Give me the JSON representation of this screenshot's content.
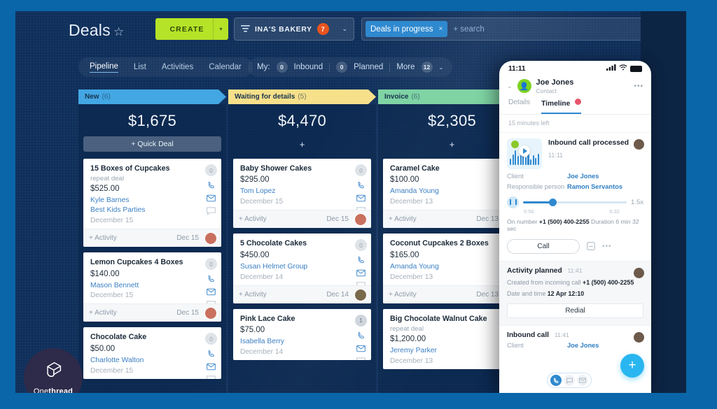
{
  "header": {
    "title": "Deals",
    "star_icon": "star-outline-icon",
    "create_label": "CREATE",
    "create_caret": "▾",
    "filter_icon": "filter-icon",
    "business": "INA'S BAKERY",
    "business_badge": "7",
    "business_caret": "⌄"
  },
  "search": {
    "chip": "Deals in progress",
    "chip_close": "×",
    "placeholder": "+ search"
  },
  "nav": {
    "tabs": [
      {
        "label": "Pipeline",
        "active": true
      },
      {
        "label": "List",
        "active": false
      },
      {
        "label": "Activities",
        "active": false
      },
      {
        "label": "Calendar",
        "active": false
      }
    ],
    "my_label": "My:",
    "inbound_count": "0",
    "inbound_label": "Inbound",
    "planned_count": "0",
    "planned_label": "Planned",
    "more_label": "More",
    "more_count": "12",
    "more_caret": "⌄"
  },
  "columns": [
    {
      "name": "New",
      "count": "(6)",
      "color": "#43a7e4",
      "sum": "$1,675",
      "action_label": "+ Quick Deal",
      "action_type": "quick",
      "cards": [
        {
          "title": "15 Boxes of Cupcakes",
          "sub": "repeat deal",
          "amount": "$525.00",
          "person": "Kyle Barnes",
          "org": "Best Kids Parties",
          "date": "December 15",
          "badge": "0",
          "foot_action": "+ Activity",
          "foot_date": "Dec 15"
        },
        {
          "title": "Lemon Cupcakes 4 Boxes",
          "sub": "",
          "amount": "$140.00",
          "person": "Mason Bennett",
          "org": "",
          "date": "December 15",
          "badge": "0",
          "foot_action": "+ Activity",
          "foot_date": "Dec 15"
        },
        {
          "title": "Chocolate Cake",
          "sub": "",
          "amount": "$50.00",
          "person": "Charlotte Walton",
          "org": "",
          "date": "December 15",
          "badge": "0",
          "foot_action": "",
          "foot_date": ""
        }
      ]
    },
    {
      "name": "Waiting for details",
      "count": "(5)",
      "color": "#f7e08a",
      "sum": "$4,470",
      "action_label": "+",
      "action_type": "plus",
      "cards": [
        {
          "title": "Baby Shower Cakes",
          "sub": "",
          "amount": "$295.00",
          "person": "Tom Lopez",
          "org": "",
          "date": "December 15",
          "badge": "0",
          "foot_action": "+ Activity",
          "foot_date": "Dec 15"
        },
        {
          "title": "5 Chocolate Cakes",
          "sub": "",
          "amount": "$450.00",
          "person": "Susan Helmet Group",
          "org": "",
          "date": "December 14",
          "badge": "0",
          "foot_action": "+ Activity",
          "foot_date": "Dec 14"
        },
        {
          "title": "Pink Lace Cake",
          "sub": "",
          "amount": "$75.00",
          "person": "Isabella Berry",
          "org": "",
          "date": "December 14",
          "badge": "1",
          "foot_action": "",
          "foot_date": ""
        }
      ]
    },
    {
      "name": "Invoice",
      "count": "(6)",
      "color": "#7fd3a4",
      "sum": "$2,305",
      "action_label": "+",
      "action_type": "plus",
      "cards": [
        {
          "title": "Caramel Cake",
          "sub": "",
          "amount": "$100.00",
          "person": "Amanda Young",
          "org": "",
          "date": "December 13",
          "badge": "0",
          "foot_action": "+ Activity",
          "foot_date": "Dec 13"
        },
        {
          "title": "Coconut Cupcakes 2 Boxes",
          "sub": "",
          "amount": "$165.00",
          "person": "Amanda Young",
          "org": "",
          "date": "December 13",
          "badge": "0",
          "foot_action": "+ Activity",
          "foot_date": "Dec 13"
        },
        {
          "title": "Big Chocolate Walnut Cake",
          "sub": "repeat deal",
          "amount": "$1,200.00",
          "person": "Jeremy Parker",
          "org": "",
          "date": "December 13",
          "badge": "0",
          "foot_action": "",
          "foot_date": ""
        }
      ]
    }
  ],
  "phone": {
    "status_time": "11:11",
    "signal_icon": "cellular-signal-icon",
    "wifi_icon": "wifi-icon",
    "battery_icon": "battery-icon",
    "contact_name": "Joe Jones",
    "contact_role": "Contact",
    "chevron_icon": "chevron-down-icon",
    "more_icon": "more-horizontal-icon",
    "tabs": [
      {
        "label": "Details",
        "active": false
      },
      {
        "label": "Timeline",
        "active": true
      }
    ],
    "timeline_dot": "notification-dot-icon",
    "time_left": "15 minutes left",
    "record": {
      "title": "Inbound call processed",
      "time": "11:11",
      "client_label": "Client",
      "client_value": "Joe Jones",
      "responsible_label": "Responsible person",
      "responsible_value": "Ramon Servantos",
      "play_icon": "play-icon",
      "pause_icon": "pause-icon",
      "rate": "1.5x",
      "elapsed": "0:56",
      "duration": "6:32",
      "on_number_label": "On number",
      "on_number": "+1 (500) 400-2255",
      "duration_label": "Duration 6 min 32 sec",
      "call_button": "Call",
      "note_icon": "note-icon",
      "more_icon": "more-horizontal-icon"
    },
    "activity": {
      "title": "Activity planned",
      "time": "11:41",
      "created_label": "Created from incoming call",
      "created_number": "+1 (500) 400-2255",
      "datetime_label": "Date and time",
      "datetime_value": "12 Apr 12:10",
      "redial_label": "Redial"
    },
    "inbound": {
      "title": "Inbound call",
      "time": "11:41",
      "client_label": "Client",
      "client_value": "Joe Jones"
    },
    "channels": [
      {
        "icon": "phone-icon",
        "active": true
      },
      {
        "icon": "chat-icon",
        "active": false
      },
      {
        "icon": "mail-icon",
        "active": false
      }
    ],
    "fab_icon": "plus-icon"
  },
  "logo": {
    "name_light": "One",
    "name_bold": "thread",
    "mark": "onethread-logo-icon"
  }
}
